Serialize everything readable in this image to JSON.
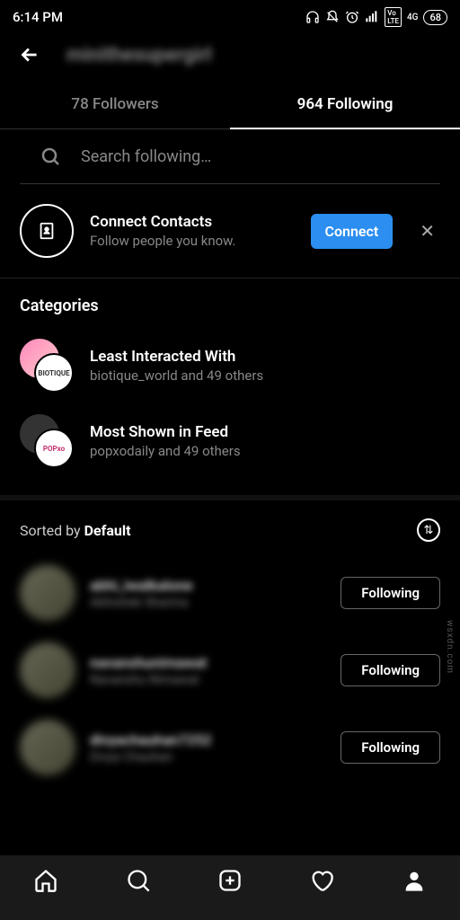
{
  "status": {
    "time": "6:14 PM",
    "battery": "68"
  },
  "header": {
    "username": "minithesupergirl"
  },
  "tabs": {
    "followers": "78 Followers",
    "following": "964 Following"
  },
  "search": {
    "placeholder": "Search following…"
  },
  "connect": {
    "title": "Connect Contacts",
    "subtitle": "Follow people you know.",
    "button": "Connect"
  },
  "categories": {
    "heading": "Categories",
    "items": [
      {
        "title": "Least Interacted With",
        "subtitle": "biotique_world and 49 others",
        "badge": "BIOTIQUE"
      },
      {
        "title": "Most Shown in Feed",
        "subtitle": "popxodaily and 49 others",
        "badge": "POPxo"
      }
    ]
  },
  "sort": {
    "prefix": "Sorted by ",
    "value": "Default"
  },
  "users": [
    {
      "handle": "abhi_iwalkalone",
      "name": "Abhishek Sharma",
      "button": "Following"
    },
    {
      "handle": "navanshunimawat",
      "name": "Navanshu Nimawat",
      "button": "Following"
    },
    {
      "handle": "divyachauhan7252",
      "name": "Divya Chauhan",
      "button": "Following"
    }
  ],
  "watermark": "wsxdn.com"
}
